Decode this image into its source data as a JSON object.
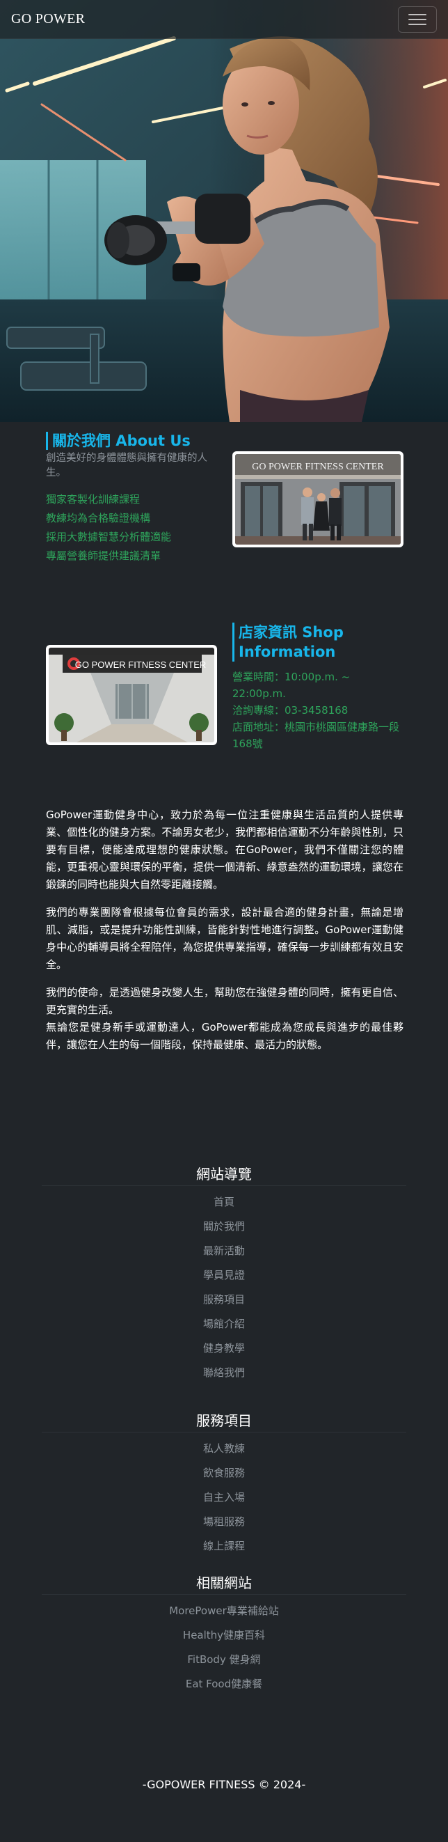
{
  "navbar": {
    "brand": "GO POWER",
    "toggle_icon": "hamburger-menu-icon"
  },
  "hero": {
    "image": "woman-lifting-dumbbell-gym-photo"
  },
  "about": {
    "title": "關於我們 About Us",
    "subtitle": "創造美好的身體體態與擁有健康的人生。",
    "items": [
      "獨家客製化訓練課程",
      "教練均為合格驗證機構",
      "採用大數據智慧分析體適能",
      "專屬營養師提供建議清單"
    ],
    "photo_sign": "GO POWER FITNESS CENTER"
  },
  "shop": {
    "title": "店家資訊 Shop Information",
    "hours": "營業時間：10:00p.m. ~ 22:00p.m.",
    "phone": "洽詢專線：03-3458168",
    "address": "店面地址：桃園市桃園區健康路一段168號",
    "photo_sign": "GO POWER FITNESS CENTER"
  },
  "intro": {
    "p1": "GoPower運動健身中心，致力於為每一位注重健康與生活品質的人提供專業、個性化的健身方案。不論男女老少，我們都相信運動不分年齡與性別，只要有目標，便能達成理想的健康狀態。在GoPower，我們不僅關注您的體能，更重視心靈與環保的平衡，提供一個清新、綠意盎然的運動環境，讓您在鍛鍊的同時也能與大自然零距離接觸。",
    "p2": "我們的專業團隊會根據每位會員的需求，設計最合適的健身計畫，無論是增肌、減脂，或是提升功能性訓練，皆能針對性地進行調整。GoPower運動健身中心的輔導員將全程陪伴，為您提供專業指導，確保每一步訓練都有效且安全。",
    "p3a": "我們的使命，是透過健身改變人生，幫助您在強健身體的同時，擁有更自信、更充實的生活。",
    "p3b": "無論您是健身新手或運動達人，GoPower都能成為您成長與進步的最佳夥伴，讓您在人生的每一個階段，保持最健康、最活力的狀態。"
  },
  "footer": {
    "nav_title": "網站導覽",
    "nav_items": [
      "首頁",
      "關於我們",
      "最新活動",
      "學員見證",
      "服務項目",
      "場館介紹",
      "健身教學",
      "聯絡我們"
    ],
    "service_title": "服務項目",
    "service_items": [
      "私人教練",
      "飲食服務",
      "自主入場",
      "場租服務",
      "線上課程"
    ],
    "related_title": "相關網站",
    "related_items": [
      "MorePower專業補給站",
      "Healthy健康百科",
      "FitBody 健身網",
      "Eat Food健康餐"
    ],
    "copyright": "-GOPOWER FITNESS © 2024-"
  }
}
